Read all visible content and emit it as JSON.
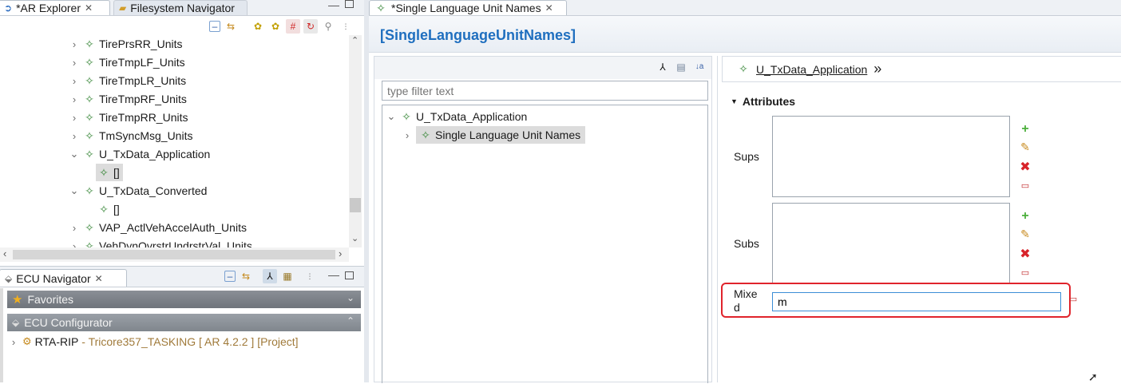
{
  "left_tabs": {
    "ar_explorer": "*AR Explorer",
    "filesystem_navigator": "Filesystem Navigator"
  },
  "tree_items": [
    {
      "label": "TirePrsRR_Units"
    },
    {
      "label": "TireTmpLF_Units"
    },
    {
      "label": "TireTmpLR_Units"
    },
    {
      "label": "TireTmpRF_Units"
    },
    {
      "label": "TireTmpRR_Units"
    },
    {
      "label": "TmSyncMsg_Units"
    },
    {
      "label": "U_TxData_Application"
    },
    {
      "label": "[]"
    },
    {
      "label": "U_TxData_Converted"
    },
    {
      "label": "[]"
    },
    {
      "label": "VAP_ActlVehAccelAuth_Units"
    },
    {
      "label": "VehDynOvrstrUndrstrVal_Units"
    }
  ],
  "ecu_navigator": {
    "title": "ECU Navigator",
    "favorites": "Favorites",
    "ecu_configurator": "ECU Configurator",
    "project_name": "RTA-RIP",
    "project_desc": " - Tricore357_TASKING [ AR 4.2.2 ] [Project]"
  },
  "editor": {
    "tab_title": "*Single Language Unit Names",
    "header_title": "[SingleLanguageUnitNames]",
    "filter_placeholder": "type filter text",
    "outline_root": "U_TxData_Application",
    "outline_child": "Single Language Unit Names",
    "breadcrumb_link": "U_TxData_Application",
    "attributes_label": "Attributes",
    "sups_label": "Sups",
    "subs_label": "Subs",
    "mixed_label": "Mixe\nd",
    "mixed_value": "m"
  },
  "colors": {
    "accent_blue": "#1f6fbf",
    "highlight_red": "#e0242c",
    "node_green": "#3d8a3d",
    "project_desc": "#a07a3a"
  }
}
